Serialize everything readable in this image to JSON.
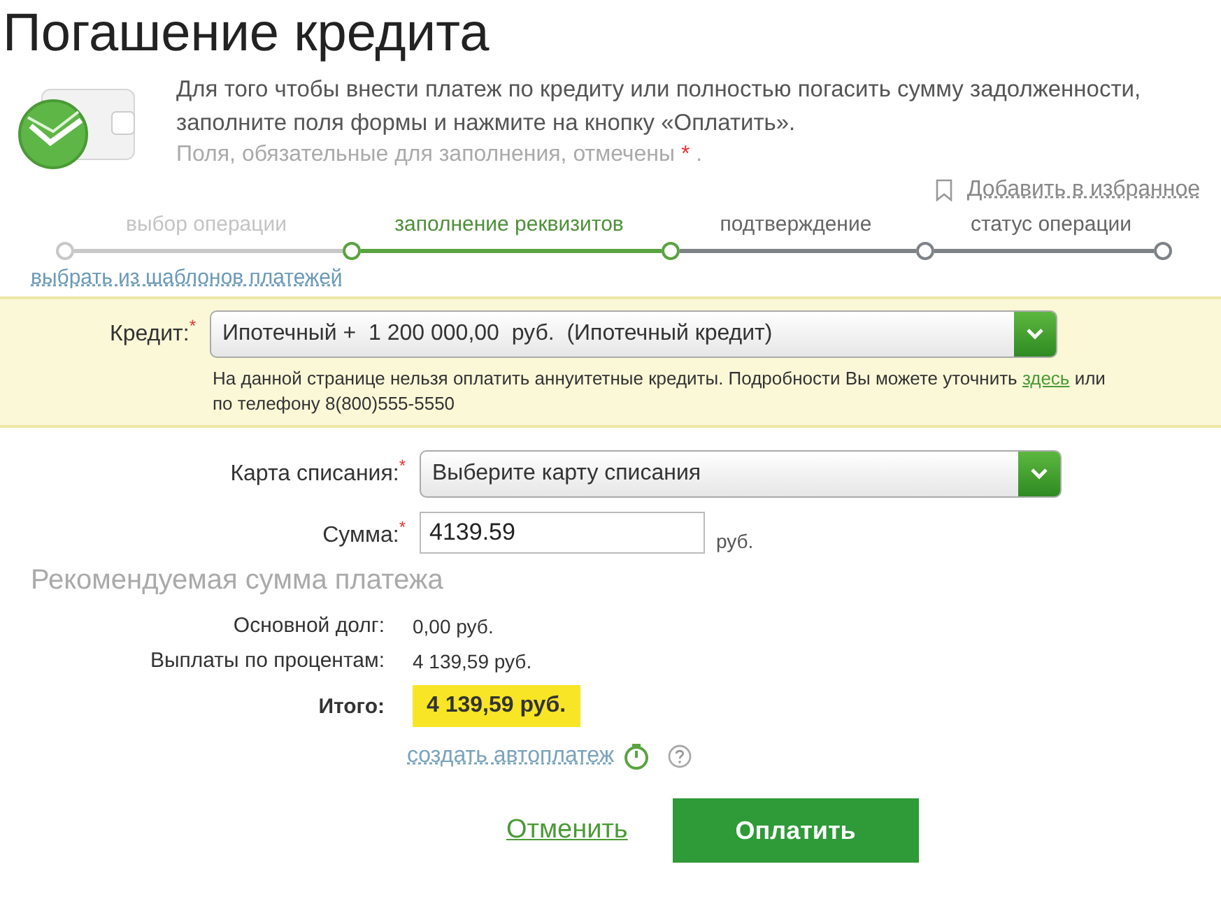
{
  "page_title": "Погашение кредита",
  "intro": {
    "text": "Для того чтобы внести платеж по кредиту или полностью погасить сумму задолженности, заполните поля формы и нажмите на кнопку «Оплатить».",
    "required_note": "Поля, обязательные для заполнения, отмечены",
    "required_mark": "*",
    "required_end": "."
  },
  "favorite_link": "Добавить в избранное",
  "steps": [
    {
      "label": "выбор операции",
      "selected": false,
      "completed": true
    },
    {
      "label": "заполнение реквизитов",
      "selected": true,
      "completed": false
    },
    {
      "label": "подтверждение",
      "selected": false,
      "completed": false
    },
    {
      "label": "статус операции",
      "selected": false,
      "completed": false
    }
  ],
  "templates_link": "выбрать из шаблонов платежей",
  "credit": {
    "label": "Кредит:",
    "required_mark": "*",
    "value": "Ипотечный +  1 200 000,00  руб.  (Ипотечный кредит)",
    "notice_before": "На данной странице нельзя оплатить аннуитетные кредиты. Подробности Вы можете уточнить",
    "notice_link": "здесь",
    "notice_after": "или по телефону 8(800)555-5550"
  },
  "card": {
    "label": "Карта списания:",
    "required_mark": "*",
    "placeholder": "Выберите карту списания"
  },
  "amount": {
    "label": "Сумма:",
    "required_mark": "*",
    "value": "4139.59",
    "unit": "руб."
  },
  "recommended": {
    "title": "Рекомендуемая сумма платежа",
    "rows": [
      {
        "label": "Основной долг:",
        "value": "0,00 руб."
      },
      {
        "label": "Выплаты по процентам:",
        "value": "4 139,59 руб."
      }
    ],
    "total_label": "Итого:",
    "total_value": "4 139,59 руб."
  },
  "autopay_link": "создать автоплатеж",
  "cancel_link": "Отменить",
  "pay_button": "Оплатить"
}
